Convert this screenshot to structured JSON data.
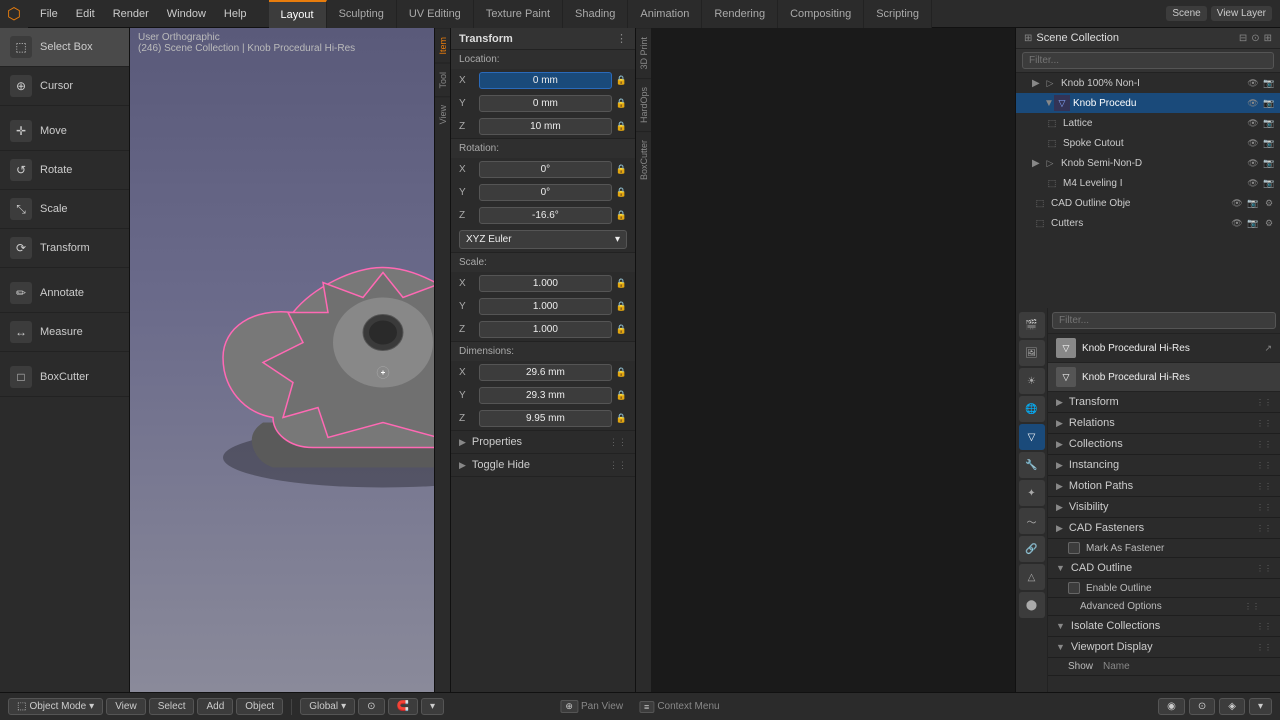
{
  "app": {
    "title": "Blender"
  },
  "topmenu": {
    "icon": "⬡",
    "menus": [
      "File",
      "Edit",
      "Render",
      "Window",
      "Help"
    ],
    "workspaces": [
      {
        "label": "Layout",
        "active": false
      },
      {
        "label": "Sculpting",
        "active": false
      },
      {
        "label": "UV Editing",
        "active": false
      },
      {
        "label": "Texture Paint",
        "active": false
      },
      {
        "label": "Shading",
        "active": false
      },
      {
        "label": "Animation",
        "active": false
      },
      {
        "label": "Rendering",
        "active": false
      },
      {
        "label": "Compositing",
        "active": false
      },
      {
        "label": "Scripting",
        "active": false
      }
    ],
    "scene_label": "Scene",
    "viewlayer_label": "View Layer"
  },
  "toolbar": {
    "tools": [
      {
        "id": "select-box",
        "label": "Select Box",
        "icon": "⬚",
        "active": true
      },
      {
        "id": "cursor",
        "label": "Cursor",
        "icon": "⊕"
      },
      {
        "id": "move",
        "label": "Move",
        "icon": "✛"
      },
      {
        "id": "rotate",
        "label": "Rotate",
        "icon": "↺"
      },
      {
        "id": "scale",
        "label": "Scale",
        "icon": "⤡"
      },
      {
        "id": "transform",
        "label": "Transform",
        "icon": "⟳"
      },
      {
        "id": "annotate",
        "label": "Annotate",
        "icon": "✏"
      },
      {
        "id": "measure",
        "label": "Measure",
        "icon": "📏"
      },
      {
        "id": "boxcutter",
        "label": "BoxCutter",
        "icon": "□"
      }
    ]
  },
  "viewport": {
    "mode": "User Orthographic",
    "scene_info": "(246) Scene Collection | Knob Procedural Hi-Res",
    "object_mode": "Object Mode"
  },
  "transform": {
    "title": "Transform",
    "location": {
      "label": "Location:",
      "x": {
        "label": "X",
        "value": "0 mm"
      },
      "y": {
        "label": "Y",
        "value": "0 mm"
      },
      "z": {
        "label": "Z",
        "value": "10 mm"
      }
    },
    "rotation": {
      "label": "Rotation:",
      "x": {
        "label": "X",
        "value": "0°"
      },
      "y": {
        "label": "Y",
        "value": "0°"
      },
      "z": {
        "label": "Z",
        "value": "-16.6°"
      },
      "mode": "XYZ Euler"
    },
    "scale": {
      "label": "Scale:",
      "x": {
        "label": "X",
        "value": "1.000"
      },
      "y": {
        "label": "Y",
        "value": "1.000"
      },
      "z": {
        "label": "Z",
        "value": "1.000"
      }
    },
    "dimensions": {
      "label": "Dimensions:",
      "x": {
        "label": "X",
        "value": "29.6 mm"
      },
      "y": {
        "label": "Y",
        "value": "29.3 mm"
      },
      "z": {
        "label": "Z",
        "value": "9.95 mm"
      }
    },
    "properties_label": "Properties",
    "toggle_hide_label": "Toggle Hide"
  },
  "outliner": {
    "title": "Scene Collection",
    "items": [
      {
        "level": 0,
        "has_arrow": true,
        "expanded": true,
        "name": "Knob 100% Non-I",
        "icon": "▷",
        "visible": true,
        "selected": false
      },
      {
        "level": 1,
        "has_arrow": true,
        "expanded": true,
        "name": "Knob Procedu",
        "icon": "▽",
        "visible": true,
        "selected": true
      },
      {
        "level": 2,
        "has_arrow": false,
        "expanded": false,
        "name": "Lattice",
        "icon": "⬚",
        "visible": true,
        "selected": false
      },
      {
        "level": 2,
        "has_arrow": false,
        "expanded": false,
        "name": "Spoke Cutout",
        "icon": "⬚",
        "visible": true,
        "selected": false
      },
      {
        "level": 0,
        "has_arrow": true,
        "expanded": true,
        "name": "Knob Semi-Non-D",
        "icon": "▷",
        "visible": true,
        "selected": false
      },
      {
        "level": 1,
        "has_arrow": false,
        "expanded": false,
        "name": "M4 Leveling I",
        "icon": "⬚",
        "visible": true,
        "selected": false
      },
      {
        "level": 0,
        "has_arrow": false,
        "expanded": false,
        "name": "CAD Outline Obje",
        "icon": "⬚",
        "visible": true,
        "selected": false
      },
      {
        "level": 0,
        "has_arrow": false,
        "expanded": false,
        "name": "Cutters",
        "icon": "⬚",
        "visible": true,
        "selected": false
      }
    ]
  },
  "properties": {
    "active_object": "Knob Procedural Hi-Res",
    "active_object_icon": "▽",
    "sections": [
      {
        "label": "Transform",
        "expanded": true
      },
      {
        "label": "Relations",
        "expanded": false
      },
      {
        "label": "Collections",
        "expanded": false
      },
      {
        "label": "Instancing",
        "expanded": false
      },
      {
        "label": "Motion Paths",
        "expanded": false
      },
      {
        "label": "Visibility",
        "expanded": false
      },
      {
        "label": "CAD Fasteners",
        "expanded": false
      },
      {
        "label": "Mark As Fastener",
        "expanded": false,
        "has_checkbox": true,
        "checked": false
      },
      {
        "label": "CAD Outline",
        "expanded": true
      },
      {
        "label": "Enable Outline",
        "expanded": false,
        "has_checkbox": true,
        "checked": false
      },
      {
        "label": "Advanced Options",
        "expanded": false,
        "indent": true
      },
      {
        "label": "Isolate Collections",
        "expanded": false
      },
      {
        "label": "Viewport Display",
        "expanded": false
      },
      {
        "label": "Show",
        "sub": "Name",
        "expanded": false
      }
    ]
  },
  "bottom_bar": {
    "mode_label": "Object Mode",
    "global_label": "Global",
    "status_items": [
      {
        "key": "Pan View",
        "icon": "⊕"
      },
      {
        "key": "Context Menu",
        "icon": "≡"
      }
    ],
    "other_buttons": [
      "View",
      "Select",
      "Add",
      "Object"
    ]
  },
  "side_tabs": {
    "right": [
      "Item",
      "Tool",
      "View"
    ],
    "extra": [
      "3D Print",
      "HardOps",
      "BoxCutter"
    ]
  },
  "colors": {
    "accent": "#e87d0d",
    "active_blue": "#1a4a7a",
    "selected_outline": "#ff69b4",
    "bg_dark": "#1a1a1a",
    "bg_panel": "#2b2b2b",
    "bg_field": "#3c3c3c"
  }
}
